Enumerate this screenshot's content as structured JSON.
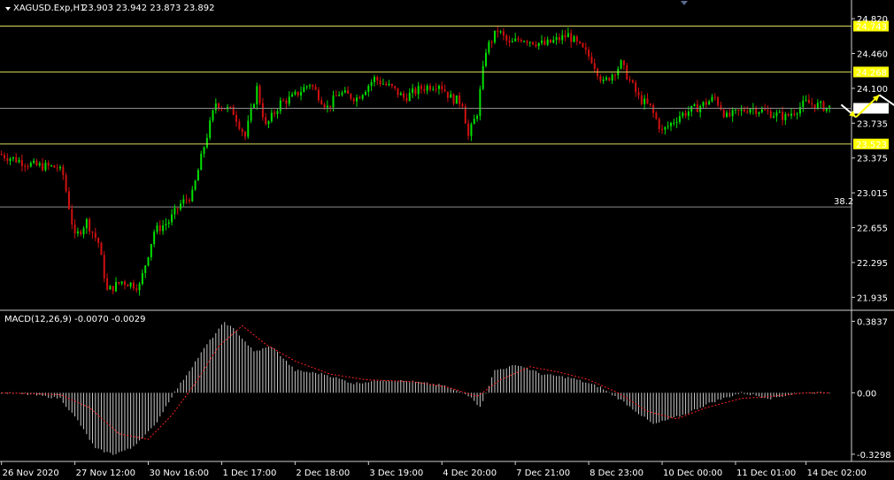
{
  "header": {
    "symbol": "XAGUSD.Exp,H1",
    "ohlc": "23.903 23.942 23.873 23.892"
  },
  "macd_header": {
    "label": "MACD(12,26,9) -0.0070 -0.0029"
  },
  "colors": {
    "background": "#000000",
    "bull": "#00e000",
    "bear": "#d01010",
    "level_line": "#d8d860",
    "grid": "#8a8a8a",
    "arrow": "#ffff00",
    "macd_hist": "#c8c8c8",
    "signal": "#ff2020"
  },
  "chart_data": [
    {
      "type": "candlestick",
      "title": "XAGUSD.Exp,H1",
      "ylim": [
        21.81,
        24.94
      ],
      "y_ticks": [
        "24.820",
        "24.460",
        "24.100",
        "23.735",
        "23.375",
        "23.015",
        "22.655",
        "22.295",
        "21.935"
      ],
      "x_ticks": [
        "26 Nov 2020",
        "27 Nov 12:00",
        "30 Nov 16:00",
        "1 Dec 17:00",
        "2 Dec 18:00",
        "3 Dec 19:00",
        "4 Dec 20:00",
        "7 Dec 21:00",
        "8 Dec 23:00",
        "10 Dec 00:00",
        "11 Dec 01:00",
        "14 Dec 02:00"
      ],
      "levels": [
        {
          "value": 24.743,
          "label": "24.743",
          "kind": "resistance"
        },
        {
          "value": 24.268,
          "label": "24.268",
          "kind": "resistance"
        },
        {
          "value": 23.523,
          "label": "23.523",
          "kind": "support"
        },
        {
          "value": 23.892,
          "label": "23.892",
          "kind": "current_price"
        }
      ],
      "fib_line": {
        "value": 22.87,
        "label": "38.2"
      },
      "anchors": [
        [
          0,
          23.42
        ],
        [
          6,
          23.36
        ],
        [
          12,
          23.3
        ],
        [
          20,
          23.28
        ],
        [
          22,
          23.2
        ],
        [
          26,
          22.55
        ],
        [
          30,
          22.72
        ],
        [
          34,
          22.5
        ],
        [
          37,
          22.0
        ],
        [
          42,
          22.1
        ],
        [
          48,
          22.05
        ],
        [
          53,
          22.62
        ],
        [
          58,
          22.72
        ],
        [
          62,
          22.9
        ],
        [
          66,
          23.0
        ],
        [
          70,
          23.5
        ],
        [
          74,
          23.95
        ],
        [
          80,
          23.85
        ],
        [
          84,
          23.6
        ],
        [
          88,
          24.1
        ],
        [
          91,
          23.7
        ],
        [
          96,
          23.95
        ],
        [
          100,
          24.0
        ],
        [
          106,
          24.15
        ],
        [
          112,
          23.9
        ],
        [
          116,
          24.05
        ],
        [
          122,
          24.0
        ],
        [
          128,
          24.2
        ],
        [
          134,
          24.1
        ],
        [
          138,
          24.0
        ],
        [
          144,
          24.1
        ],
        [
          150,
          24.15
        ],
        [
          154,
          24.0
        ],
        [
          158,
          23.95
        ],
        [
          160,
          23.6
        ],
        [
          163,
          23.85
        ],
        [
          166,
          24.5
        ],
        [
          170,
          24.7
        ],
        [
          174,
          24.55
        ],
        [
          178,
          24.62
        ],
        [
          186,
          24.55
        ],
        [
          194,
          24.65
        ],
        [
          202,
          24.4
        ],
        [
          206,
          24.15
        ],
        [
          212,
          24.35
        ],
        [
          218,
          24.0
        ],
        [
          222,
          23.9
        ],
        [
          226,
          23.65
        ],
        [
          232,
          23.82
        ],
        [
          238,
          23.9
        ],
        [
          244,
          24.0
        ],
        [
          248,
          23.8
        ],
        [
          256,
          23.9
        ],
        [
          262,
          23.85
        ],
        [
          268,
          23.8
        ],
        [
          275,
          23.95
        ],
        [
          282,
          23.9
        ]
      ],
      "forecast": [
        {
          "x": 286,
          "y": 23.93
        },
        {
          "x": 291,
          "y": 23.8
        },
        {
          "x": 299,
          "y": 24.03
        },
        {
          "x": 310,
          "y": 23.8
        },
        {
          "x": 322,
          "y": 24.26
        }
      ]
    },
    {
      "type": "macd",
      "title": "MACD(12,26,9) -0.0070 -0.0029",
      "ylim": [
        -0.34,
        0.4
      ],
      "y_ticks": [
        "0.3837",
        "0.00",
        "-0.3298"
      ],
      "macd": [
        [
          0,
          0.0
        ],
        [
          10,
          -0.01
        ],
        [
          20,
          -0.03
        ],
        [
          26,
          -0.15
        ],
        [
          32,
          -0.3
        ],
        [
          38,
          -0.33
        ],
        [
          44,
          -0.3
        ],
        [
          52,
          -0.18
        ],
        [
          58,
          -0.02
        ],
        [
          64,
          0.12
        ],
        [
          70,
          0.26
        ],
        [
          76,
          0.38
        ],
        [
          80,
          0.33
        ],
        [
          86,
          0.22
        ],
        [
          92,
          0.25
        ],
        [
          100,
          0.12
        ],
        [
          110,
          0.1
        ],
        [
          120,
          0.05
        ],
        [
          130,
          0.07
        ],
        [
          140,
          0.06
        ],
        [
          150,
          0.04
        ],
        [
          160,
          -0.02
        ],
        [
          163,
          -0.08
        ],
        [
          168,
          0.12
        ],
        [
          176,
          0.15
        ],
        [
          184,
          0.1
        ],
        [
          194,
          0.08
        ],
        [
          204,
          0.03
        ],
        [
          212,
          -0.05
        ],
        [
          222,
          -0.17
        ],
        [
          232,
          -0.12
        ],
        [
          242,
          -0.05
        ],
        [
          252,
          0.0
        ],
        [
          262,
          -0.03
        ],
        [
          272,
          0.0
        ]
      ],
      "signal": [
        [
          0,
          0.0
        ],
        [
          20,
          -0.01
        ],
        [
          30,
          -0.08
        ],
        [
          40,
          -0.22
        ],
        [
          50,
          -0.25
        ],
        [
          58,
          -0.12
        ],
        [
          66,
          0.05
        ],
        [
          74,
          0.25
        ],
        [
          82,
          0.36
        ],
        [
          90,
          0.26
        ],
        [
          100,
          0.17
        ],
        [
          112,
          0.1
        ],
        [
          124,
          0.07
        ],
        [
          140,
          0.06
        ],
        [
          152,
          0.03
        ],
        [
          162,
          -0.02
        ],
        [
          170,
          0.07
        ],
        [
          180,
          0.14
        ],
        [
          190,
          0.11
        ],
        [
          200,
          0.07
        ],
        [
          210,
          0.0
        ],
        [
          220,
          -0.1
        ],
        [
          230,
          -0.14
        ],
        [
          240,
          -0.08
        ],
        [
          252,
          -0.03
        ],
        [
          262,
          -0.02
        ],
        [
          274,
          0.0
        ],
        [
          282,
          0.0
        ]
      ]
    }
  ]
}
